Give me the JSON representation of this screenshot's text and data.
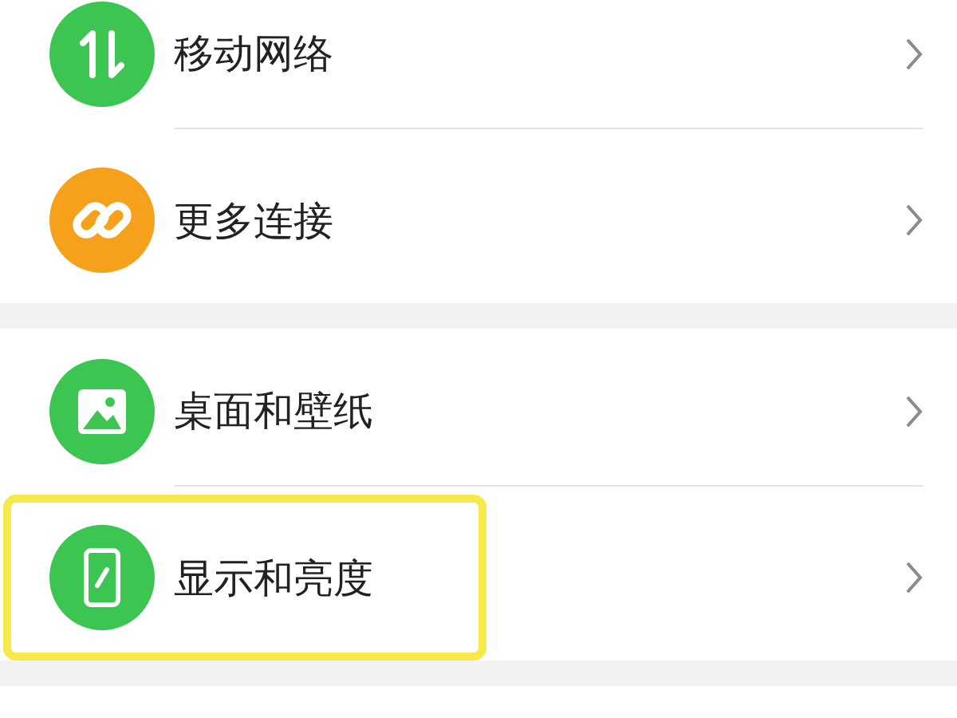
{
  "groups": [
    {
      "items": [
        {
          "label": "移动网络",
          "kind": "arrows",
          "color": "#3dc552",
          "highlighted": false
        },
        {
          "label": "更多连接",
          "kind": "link",
          "color": "#f5a11c",
          "highlighted": false
        }
      ]
    },
    {
      "items": [
        {
          "label": "桌面和壁纸",
          "kind": "image",
          "color": "#3dc552",
          "highlighted": false
        },
        {
          "label": "显示和亮度",
          "kind": "phone",
          "color": "#3dc552",
          "highlighted": true
        }
      ]
    }
  ]
}
